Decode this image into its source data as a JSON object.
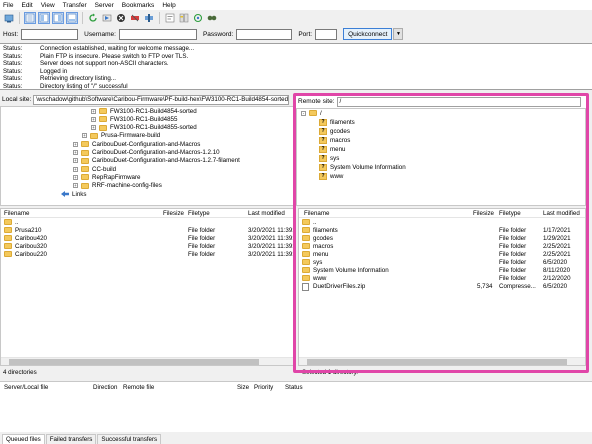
{
  "menu": [
    "File",
    "Edit",
    "View",
    "Transfer",
    "Server",
    "Bookmarks",
    "Help"
  ],
  "toolbar_icons": [
    "site-manager-icon",
    "toggle-log-icon",
    "toggle-local-tree-icon",
    "toggle-remote-tree-icon",
    "toggle-queue-icon",
    "refresh-icon",
    "process-queue-icon",
    "cancel-icon",
    "disconnect-icon",
    "reconnect-icon",
    "filter-icon",
    "compare-icon",
    "sync-browse-icon",
    "search-icon"
  ],
  "quickconnect": {
    "host_label": "Host:",
    "username_label": "Username:",
    "password_label": "Password:",
    "port_label": "Port:",
    "button_label": "Quickconnect",
    "dropdown_glyph": "▼"
  },
  "log": [
    {
      "k": "Status:",
      "v": "Connection established, waiting for welcome message..."
    },
    {
      "k": "Status:",
      "v": "Plain FTP is insecure. Please switch to FTP over TLS."
    },
    {
      "k": "Status:",
      "v": "Server does not support non-ASCII characters."
    },
    {
      "k": "Status:",
      "v": "Logged in"
    },
    {
      "k": "Status:",
      "v": "Retrieving directory listing..."
    },
    {
      "k": "Status:",
      "v": "Directory listing of \"/\" successful"
    }
  ],
  "local": {
    "site_label": "Local site:",
    "path": "\\wschadow\\github\\Software\\Caribou-Firmware\\PF-build-hex\\FW3100-RC1-Build4854-sorted\\",
    "tree": [
      {
        "label": "FW3100-RC1-Build4854-sorted",
        "indent": 3,
        "exp": "+"
      },
      {
        "label": "FW3100-RC1-Build4855",
        "indent": 3,
        "exp": "+"
      },
      {
        "label": "FW3100-RC1-Build4855-sorted",
        "indent": 3,
        "exp": "+"
      },
      {
        "label": "Prusa-Firmware-build",
        "indent": 2,
        "exp": "+"
      },
      {
        "label": "CaribouDuet-Configuration-and-Macros",
        "indent": 1,
        "exp": "+"
      },
      {
        "label": "CaribouDuet-Configuration-and-Macros-1.2.10",
        "indent": 1,
        "exp": "+"
      },
      {
        "label": "CaribouDuet-Configuration-and-Macros-1.2.7-filament",
        "indent": 1,
        "exp": "+"
      },
      {
        "label": "CC-build",
        "indent": 1,
        "exp": "+"
      },
      {
        "label": "RepRapFirmware",
        "indent": 1,
        "exp": "+"
      },
      {
        "label": "RRF-machine-config-files",
        "indent": 1,
        "exp": "+"
      },
      {
        "label": "Links",
        "indent": 0,
        "exp": "",
        "icon": "links"
      }
    ],
    "headers": [
      "Filename",
      "Filesize",
      "Filetype",
      "Last modified"
    ],
    "files": [
      {
        "name": "..",
        "type": "",
        "date": ""
      },
      {
        "name": "Prusa210",
        "type": "File folder",
        "date": "3/20/2021 11:39:3"
      },
      {
        "name": "Caribou420",
        "type": "File folder",
        "date": "3/20/2021 11:39:3"
      },
      {
        "name": "Caribou320",
        "type": "File folder",
        "date": "3/20/2021 11:39:3"
      },
      {
        "name": "Caribou220",
        "type": "File folder",
        "date": "3/20/2021 11:39:3"
      }
    ],
    "status": "4 directories"
  },
  "remote": {
    "site_label": "Remote site:",
    "path": "/",
    "tree_root": "/",
    "tree": [
      "filaments",
      "gcodes",
      "macros",
      "menu",
      "sys",
      "System Volume Information",
      "www"
    ],
    "headers": [
      "Filename",
      "Filesize",
      "Filetype",
      "Last modified"
    ],
    "sort_glyph": "^",
    "files": [
      {
        "name": "..",
        "size": "",
        "type": "",
        "date": "",
        "icon": "folder"
      },
      {
        "name": "filaments",
        "size": "",
        "type": "File folder",
        "date": "1/17/2021",
        "icon": "folder"
      },
      {
        "name": "gcodes",
        "size": "",
        "type": "File folder",
        "date": "1/29/2021",
        "icon": "folder"
      },
      {
        "name": "macros",
        "size": "",
        "type": "File folder",
        "date": "2/25/2021",
        "icon": "folder"
      },
      {
        "name": "menu",
        "size": "",
        "type": "File folder",
        "date": "2/25/2021",
        "icon": "folder"
      },
      {
        "name": "sys",
        "size": "",
        "type": "File folder",
        "date": "6/5/2020",
        "icon": "folder"
      },
      {
        "name": "System Volume Information",
        "size": "",
        "type": "File folder",
        "date": "8/11/2020",
        "icon": "folder"
      },
      {
        "name": "www",
        "size": "",
        "type": "File folder",
        "date": "2/12/2020",
        "icon": "folder"
      },
      {
        "name": "DuetDriverFiles.zip",
        "size": "5,734",
        "type": "Compresse...",
        "date": "6/5/2020",
        "icon": "file"
      }
    ],
    "status": "Selected 1 directory."
  },
  "queue": {
    "headers": [
      "Server/Local file",
      "Direction",
      "Remote file",
      "Size",
      "Priority",
      "Status"
    ],
    "tabs": [
      "Queued files",
      "Failed transfers",
      "Successful transfers"
    ]
  },
  "colors": {
    "highlight": "#e046a8",
    "folder": "#f4c95c"
  }
}
